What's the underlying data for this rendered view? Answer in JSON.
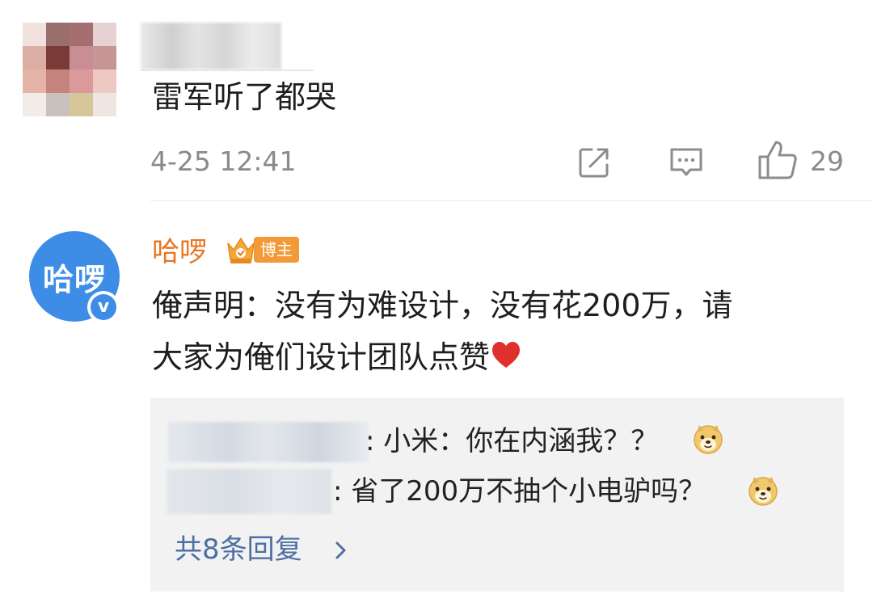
{
  "comments": [
    {
      "text": "雷军听了都哭",
      "time": "4-25 12:41",
      "likes": "29",
      "icons": [
        "share-icon",
        "reply-icon",
        "like-icon"
      ]
    },
    {
      "avatar_text": "哈啰",
      "author": "哈啰",
      "badge": "博主",
      "verified_mark": "v",
      "text_line1": "俺声明：没有为难设计，没有花200万，请",
      "text_line2": "大家为俺们设计团队点赞",
      "text_emoji": "heart-emoji",
      "replies": [
        {
          "text": ": 小米：你在内涵我？？",
          "emoji": "doge-emoji"
        },
        {
          "text": ": 省了200万不抽个小电驴吗？",
          "emoji": "doge-emoji"
        }
      ],
      "more_replies": "共8条回复"
    }
  ],
  "colors": {
    "author": "#e8761f",
    "badge": "#f29a37",
    "avatar": "#3d8ce6",
    "link": "#4d6fa3",
    "meta": "#8a8a8a",
    "reply_bg": "#f2f2f2"
  }
}
